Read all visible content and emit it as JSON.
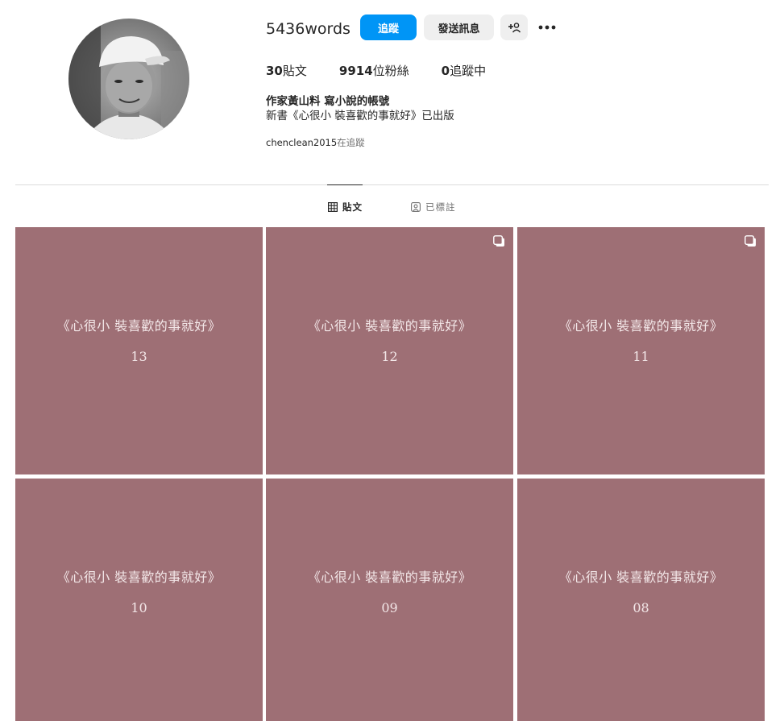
{
  "profile": {
    "username": "5436words",
    "follow_label": "追蹤",
    "message_label": "發送訊息",
    "suggest_icon_text": "+☺",
    "more_label": "•••",
    "stats": {
      "posts_count": "30",
      "posts_label": "貼文",
      "followers_count": "9914",
      "followers_label": "位粉絲",
      "following_count": "0",
      "following_label": "追蹤中"
    },
    "bio_name": "作家黃山料 寫小說的帳號",
    "bio_text": "新書《心很小 裝喜歡的事就好》已出版",
    "followed_by_user": "chenclean2015",
    "followed_by_suffix": "在追蹤"
  },
  "tabs": {
    "posts_label": "貼文",
    "tagged_label": "已標註"
  },
  "posts": [
    {
      "title": "《心很小  裝喜歡的事就好》",
      "number": "13",
      "multi": false
    },
    {
      "title": "《心很小  裝喜歡的事就好》",
      "number": "12",
      "multi": true
    },
    {
      "title": "《心很小  裝喜歡的事就好》",
      "number": "11",
      "multi": true
    },
    {
      "title": "《心很小  裝喜歡的事就好》",
      "number": "10",
      "multi": false
    },
    {
      "title": "《心很小  裝喜歡的事就好》",
      "number": "09",
      "multi": false
    },
    {
      "title": "《心很小  裝喜歡的事就好》",
      "number": "08",
      "multi": false
    }
  ],
  "colors": {
    "accent": "#0095f6",
    "post_background": "#9e6f75",
    "post_text": "#f3e7e8"
  }
}
